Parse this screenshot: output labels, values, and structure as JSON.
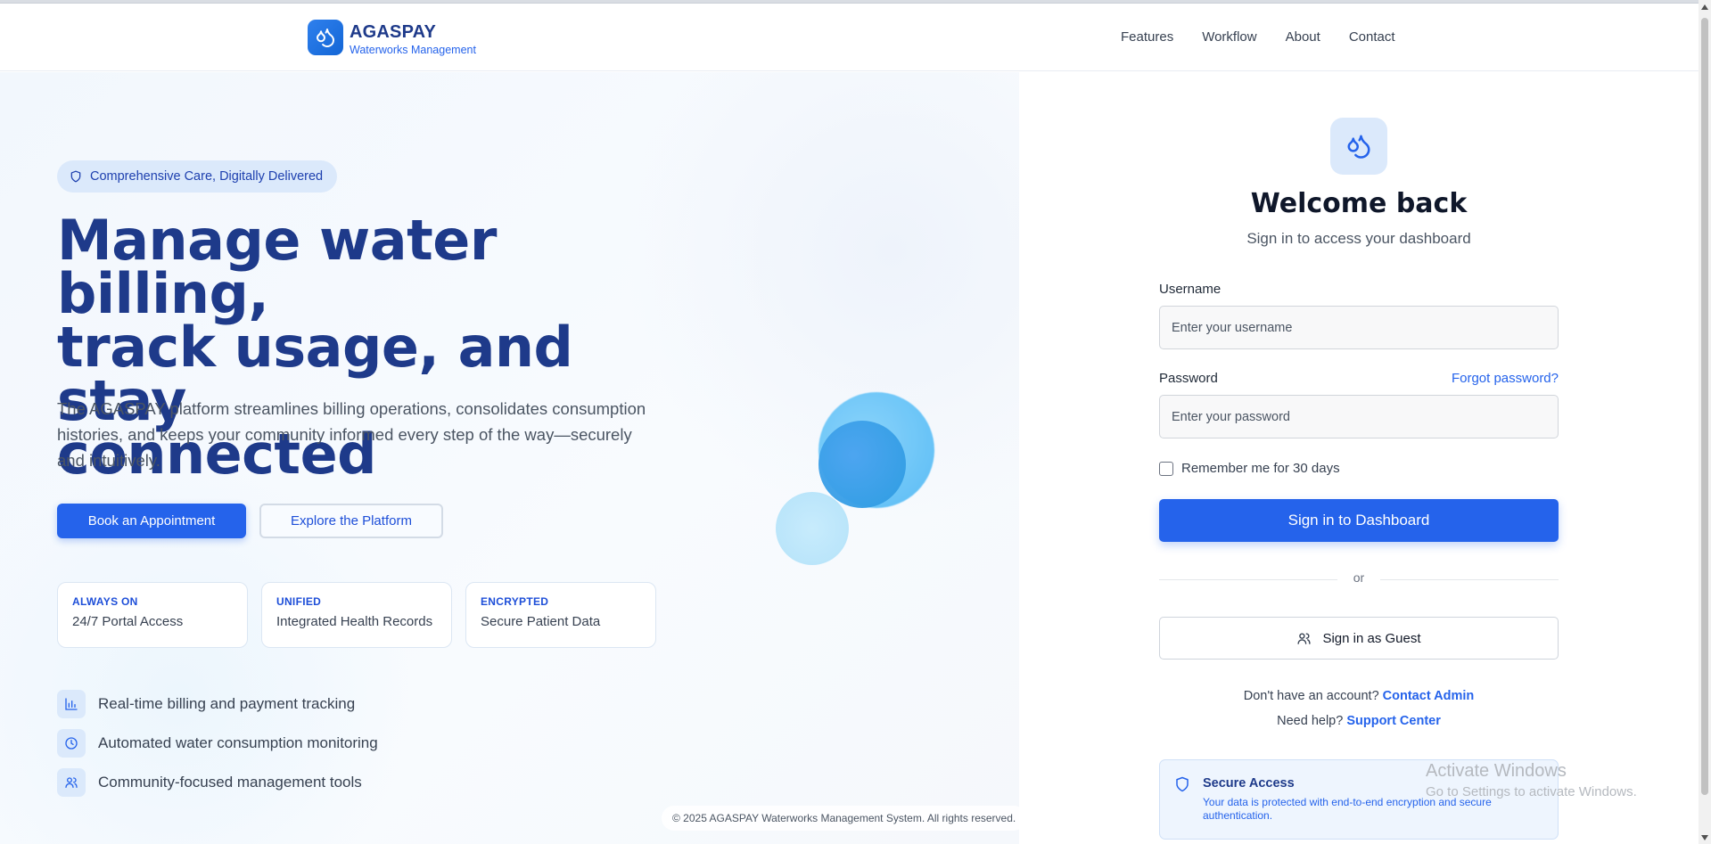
{
  "brand": {
    "name": "AGASPAY",
    "subtitle": "Waterworks Management"
  },
  "nav": [
    "Features",
    "Workflow",
    "About",
    "Contact"
  ],
  "hero": {
    "badge": "Comprehensive Care, Digitally Delivered",
    "title_lines": [
      "Manage water billing,",
      "track usage, and stay",
      "connected"
    ],
    "description": "The AGASPAY platform streamlines billing operations, consolidates consumption histories, and keeps your community informed every step of the way—securely and intuitively.",
    "primary_button": "Book an Appointment",
    "secondary_button": "Explore the Platform"
  },
  "stats": [
    {
      "key": "ALWAYS ON",
      "value": "24/7 Portal Access"
    },
    {
      "key": "UNIFIED",
      "value": "Integrated Health Records"
    },
    {
      "key": "ENCRYPTED",
      "value": "Secure Patient Data"
    }
  ],
  "features": [
    {
      "icon": "bar-chart-icon",
      "text": "Real-time billing and payment tracking"
    },
    {
      "icon": "clock-icon",
      "text": "Automated water consumption monitoring"
    },
    {
      "icon": "users-icon",
      "text": "Community-focused management tools"
    }
  ],
  "footer": "© 2025 AGASPAY Waterworks Management System. All rights reserved.",
  "login": {
    "title": "Welcome back",
    "subtitle": "Sign in to access your dashboard",
    "username_label": "Username",
    "username_placeholder": "Enter your username",
    "password_label": "Password",
    "password_placeholder": "Enter your password",
    "forgot": "Forgot password?",
    "remember": "Remember me for 30 days",
    "signin_button": "Sign in to Dashboard",
    "or": "or",
    "guest_button": "Sign in as Guest",
    "no_account": "Don't have an account?",
    "contact_admin": "Contact Admin",
    "need_help": "Need help?",
    "support": "Support Center",
    "secure_title": "Secure Access",
    "secure_desc": "Your data is protected with end-to-end encryption and secure authentication."
  },
  "watermark": {
    "line1": "Activate Windows",
    "line2": "Go to Settings to activate Windows."
  },
  "colors": {
    "primary": "#2563eb",
    "navy": "#1e3a8a",
    "badge_bg": "#dbe9fb"
  }
}
